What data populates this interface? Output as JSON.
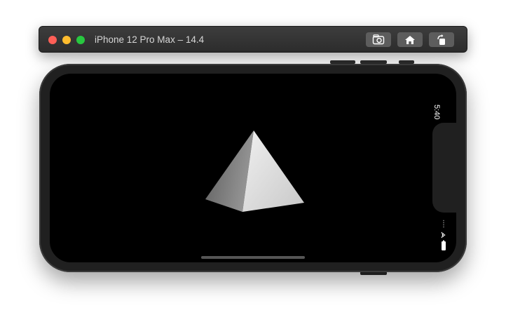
{
  "window": {
    "title": "iPhone 12 Pro Max – 14.4",
    "buttons": {
      "screenshot": "camera-icon",
      "home": "home-icon",
      "rotate": "rotate-icon"
    }
  },
  "status_bar": {
    "time": "5:40",
    "icons": [
      "cellular-dots-icon",
      "wifi-icon",
      "battery-icon"
    ]
  },
  "scene": {
    "object": "pyramid-icon",
    "colors": {
      "left_face": "#7a7a7a",
      "right_face": "#e2e2e2",
      "background": "#000000"
    }
  },
  "colors": {
    "close": "#fe5f57",
    "minimize": "#febc2e",
    "maximize": "#28c840"
  }
}
